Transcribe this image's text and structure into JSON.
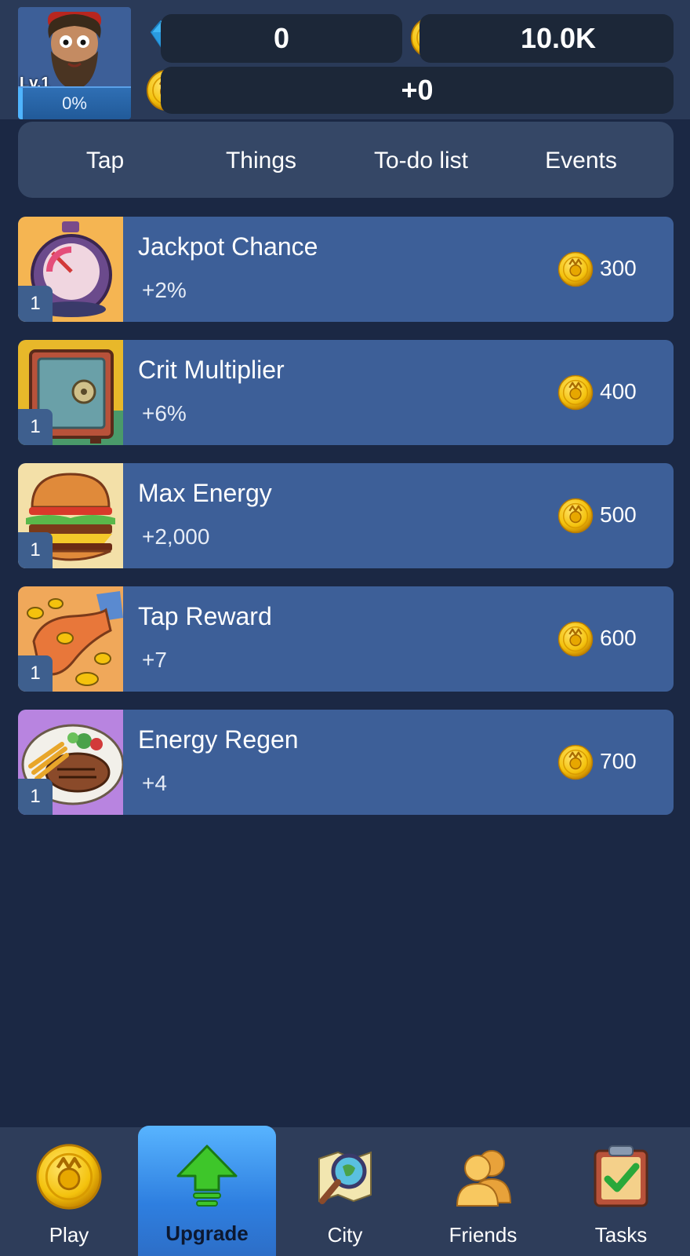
{
  "player": {
    "level": "Lv.1",
    "xp_percent_label": "0%",
    "xp_fraction": 0.0
  },
  "currency": {
    "gems": "0",
    "coins": "10.0K",
    "income": "+0"
  },
  "tabs": [
    {
      "label": "Tap",
      "active": true
    },
    {
      "label": "Things",
      "active": false
    },
    {
      "label": "To-do list",
      "active": false
    },
    {
      "label": "Events",
      "active": false
    }
  ],
  "upgrades": [
    {
      "title": "Jackpot Chance",
      "bonus": "+2%",
      "level": "1",
      "cost": "300",
      "icon": "stopwatch-icon"
    },
    {
      "title": "Crit Multiplier",
      "bonus": "+6%",
      "level": "1",
      "cost": "400",
      "icon": "safe-icon"
    },
    {
      "title": "Max Energy",
      "bonus": "+2,000",
      "level": "1",
      "cost": "500",
      "icon": "burger-icon"
    },
    {
      "title": "Tap Reward",
      "bonus": "+7",
      "level": "1",
      "cost": "600",
      "icon": "coins-hand-icon"
    },
    {
      "title": "Energy Regen",
      "bonus": "+4",
      "level": "1",
      "cost": "700",
      "icon": "steak-plate-icon"
    }
  ],
  "nav": [
    {
      "label": "Play",
      "icon": "coin-icon",
      "active": false
    },
    {
      "label": "Upgrade",
      "icon": "up-arrow-icon",
      "active": true
    },
    {
      "label": "City",
      "icon": "magnifier-map-icon",
      "active": false
    },
    {
      "label": "Friends",
      "icon": "friends-icon",
      "active": false
    },
    {
      "label": "Tasks",
      "icon": "checklist-icon",
      "active": false
    }
  ],
  "colors": {
    "background": "#1b2844",
    "card": "#3d5f98",
    "active_tab": "#6e9fd6",
    "coin": "#f4c20d"
  }
}
